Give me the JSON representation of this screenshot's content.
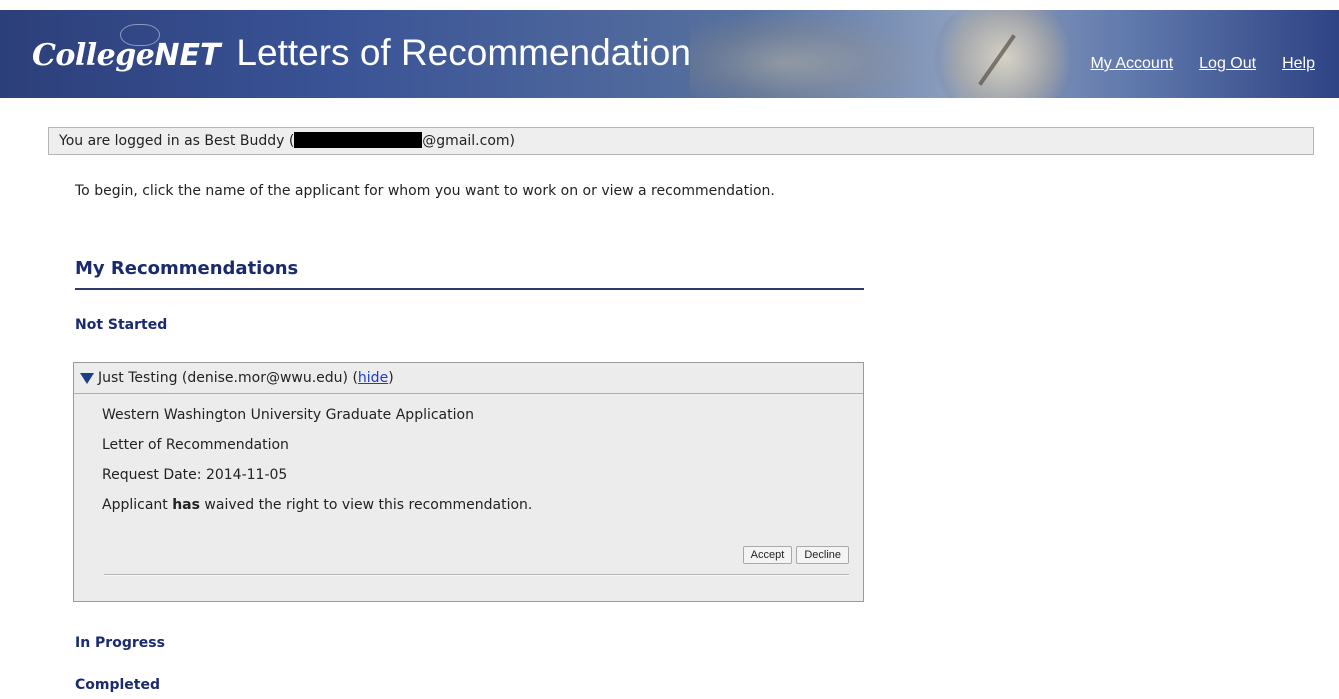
{
  "header": {
    "logo_college": "College",
    "logo_net": "NET",
    "app_title": "Letters of Recommendation",
    "nav": [
      {
        "label": "My Account"
      },
      {
        "label": "Log Out"
      },
      {
        "label": "Help"
      }
    ]
  },
  "user_bar": {
    "prefix": "You are logged in as Best Buddy (",
    "suffix": "@gmail.com)"
  },
  "intro_text": "To begin, click the name of the applicant for whom you want to work on or view a recommendation.",
  "section": {
    "title": "My Recommendations",
    "groups": {
      "not_started": "Not Started",
      "in_progress": "In Progress",
      "completed": "Completed"
    }
  },
  "card": {
    "applicant": "Just Testing (denise.mor@wwu.edu) (",
    "hide_label": "hide",
    "close_paren": ")",
    "program": "Western Washington University Graduate Application",
    "doc_type": "Letter of Recommendation",
    "request_date": "Request Date: 2014-11-05",
    "waiver_pre": "Applicant ",
    "waiver_bold": "has",
    "waiver_post": " waived the right to view this recommendation.",
    "accept_label": "Accept",
    "decline_label": "Decline"
  }
}
